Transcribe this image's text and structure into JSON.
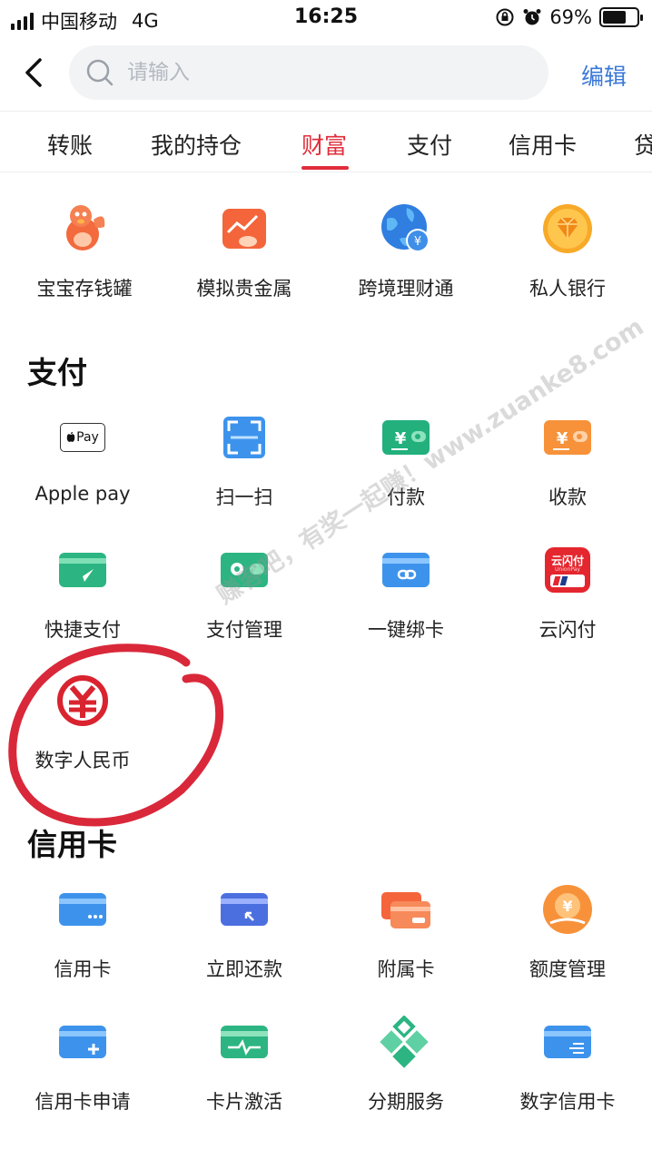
{
  "status_bar": {
    "carrier": "中国移动",
    "network": "4G",
    "time": "16:25",
    "battery": "69%",
    "battery_level": 0.69
  },
  "search": {
    "placeholder": "请输入",
    "edit_label": "编辑"
  },
  "tabs": [
    {
      "label": "转账"
    },
    {
      "label": "我的持仓"
    },
    {
      "label": "财富",
      "active": true
    },
    {
      "label": "支付"
    },
    {
      "label": "信用卡"
    },
    {
      "label": "贷"
    }
  ],
  "wealth": {
    "items": [
      {
        "label": "宝宝存钱罐",
        "icon": "piggy-bird-icon"
      },
      {
        "label": "模拟贵金属",
        "icon": "precious-metal-icon"
      },
      {
        "label": "跨境理财通",
        "icon": "globe-yuan-icon"
      },
      {
        "label": "私人银行",
        "icon": "diamond-icon"
      }
    ]
  },
  "payment": {
    "title": "支付",
    "items": [
      {
        "label": "Apple pay",
        "icon": "apple-pay-icon",
        "icon_text": "Pay"
      },
      {
        "label": "扫一扫",
        "icon": "scan-icon"
      },
      {
        "label": "付款",
        "icon": "pay-wallet-icon"
      },
      {
        "label": "收款",
        "icon": "receive-wallet-icon"
      },
      {
        "label": "快捷支付",
        "icon": "quick-pay-icon"
      },
      {
        "label": "支付管理",
        "icon": "pay-settings-icon"
      },
      {
        "label": "一键绑卡",
        "icon": "bind-card-icon"
      },
      {
        "label": "云闪付",
        "icon": "cloud-quickpass-icon",
        "icon_text": "云闪付",
        "icon_subtext": "UnionPay"
      },
      {
        "label": "数字人民币",
        "icon": "digital-rmb-icon"
      }
    ]
  },
  "credit": {
    "title": "信用卡",
    "items": [
      {
        "label": "信用卡",
        "icon": "credit-card-icon"
      },
      {
        "label": "立即还款",
        "icon": "repay-icon"
      },
      {
        "label": "附属卡",
        "icon": "supplementary-card-icon"
      },
      {
        "label": "额度管理",
        "icon": "credit-limit-icon"
      },
      {
        "label": "信用卡申请",
        "icon": "card-apply-icon"
      },
      {
        "label": "卡片激活",
        "icon": "card-activate-icon"
      },
      {
        "label": "分期服务",
        "icon": "installment-icon"
      },
      {
        "label": "数字信用卡",
        "icon": "digital-credit-card-icon"
      }
    ]
  },
  "watermark": "赚客吧，有奖一起赚！www.zuanke8.com",
  "colors": {
    "accent_red": "#e02d3a",
    "link_blue": "#3a78d8",
    "annotation_red": "#d9283a"
  }
}
